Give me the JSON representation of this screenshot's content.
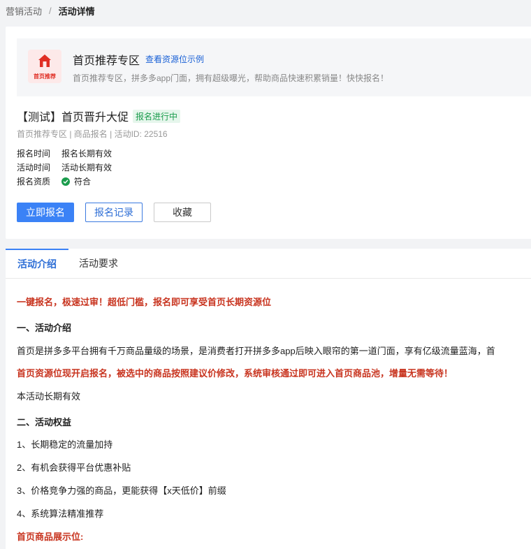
{
  "breadcrumb": {
    "parent": "营销活动",
    "separator": "/",
    "current": "活动详情"
  },
  "resource": {
    "logo_text": "首页推荐",
    "title": "首页推荐专区",
    "link": "查看资源位示例",
    "description": "首页推荐专区，拼多多app门面，拥有超级曝光，帮助商品快速积累销量！快快报名！"
  },
  "event": {
    "title": "【测试】首页晋升大促",
    "status": "报名进行中",
    "meta": "首页推荐专区 | 商品报名 | 活动ID: 22516",
    "info": [
      {
        "key": "报名时间",
        "value": "报名长期有效"
      },
      {
        "key": "活动时间",
        "value": "活动长期有效"
      },
      {
        "key": "报名资质",
        "value": "符合"
      }
    ]
  },
  "buttons": {
    "signup": "立即报名",
    "records": "报名记录",
    "favorite": "收藏"
  },
  "tabs": [
    {
      "label": "活动介绍",
      "active": true
    },
    {
      "label": "活动要求",
      "active": false
    }
  ],
  "content": {
    "headline": "一键报名，极速过审！超低门槛，报名即可享受首页长期资源位",
    "section1_title": "一、活动介绍",
    "section1_text": "首页是拼多多平台拥有千万商品量级的场景，是消费者打开拼多多app后映入眼帘的第一道门面，享有亿级流量蓝海，首",
    "highlight": "首页资源位现开启报名，被选中的商品按照建议价修改，系统审核通过即可进入首页商品池，增量无需等待！",
    "validity": "本活动长期有效",
    "section2_title": "二、活动权益",
    "benefits": [
      "1、长期稳定的流量加持",
      "2、有机会获得平台优惠补贴",
      "3、价格竞争力强的商品，更能获得【x天低价】前缀",
      "4、系统算法精准推荐"
    ],
    "display_title": "首页商品展示位:"
  },
  "colors": {
    "primary": "#3b82f6",
    "link": "#1a61d6",
    "emphasis_red": "#c8341f",
    "status_green": "#1a9c4c"
  }
}
